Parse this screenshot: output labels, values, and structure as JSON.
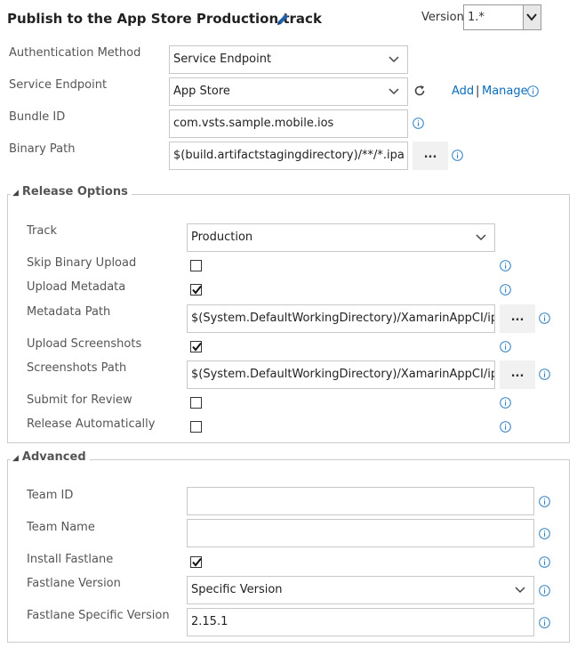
{
  "header": {
    "title": "Publish to the App Store Production track",
    "version_label": "Version",
    "version_value": "1.*"
  },
  "fields": {
    "auth_method": {
      "label": "Authentication Method",
      "value": "Service Endpoint"
    },
    "service_endpoint": {
      "label": "Service Endpoint",
      "value": "App Store",
      "add_link": "Add",
      "separator": "|",
      "manage_link": "Manage"
    },
    "bundle_id": {
      "label": "Bundle ID",
      "value": "com.vsts.sample.mobile.ios"
    },
    "binary_path": {
      "label": "Binary Path",
      "value": "$(build.artifactstagingdirectory)/**/*.ipa",
      "browse_label": "..."
    }
  },
  "release_options": {
    "legend": "Release Options",
    "track": {
      "label": "Track",
      "value": "Production"
    },
    "skip_binary_upload": {
      "label": "Skip Binary Upload",
      "checked": false
    },
    "upload_metadata": {
      "label": "Upload Metadata",
      "checked": true
    },
    "metadata_path": {
      "label": "Metadata Path",
      "value": "$(System.DefaultWorkingDirectory)/XamarinAppCI/ipa-",
      "browse_label": "..."
    },
    "upload_screenshots": {
      "label": "Upload Screenshots",
      "checked": true
    },
    "screenshots_path": {
      "label": "Screenshots Path",
      "value": "$(System.DefaultWorkingDirectory)/XamarinAppCI/ipa-",
      "browse_label": "..."
    },
    "submit_for_review": {
      "label": "Submit for Review",
      "checked": false
    },
    "release_automatically": {
      "label": "Release Automatically",
      "checked": false
    }
  },
  "advanced": {
    "legend": "Advanced",
    "team_id": {
      "label": "Team ID",
      "value": ""
    },
    "team_name": {
      "label": "Team Name",
      "value": ""
    },
    "install_fastlane": {
      "label": "Install Fastlane",
      "checked": true
    },
    "fastlane_version": {
      "label": "Fastlane Version",
      "value": "Specific Version"
    },
    "fastlane_specific_version": {
      "label": "Fastlane Specific Version",
      "value": "2.15.1"
    }
  },
  "colors": {
    "link": "#0a6ebd",
    "info_icon": "#2f7fc1",
    "border": "#c8c8c8"
  },
  "icons": [
    "pencil-icon",
    "refresh-icon",
    "info-icon",
    "chevron-down-icon",
    "check-icon",
    "collapse-triangle-icon"
  ]
}
